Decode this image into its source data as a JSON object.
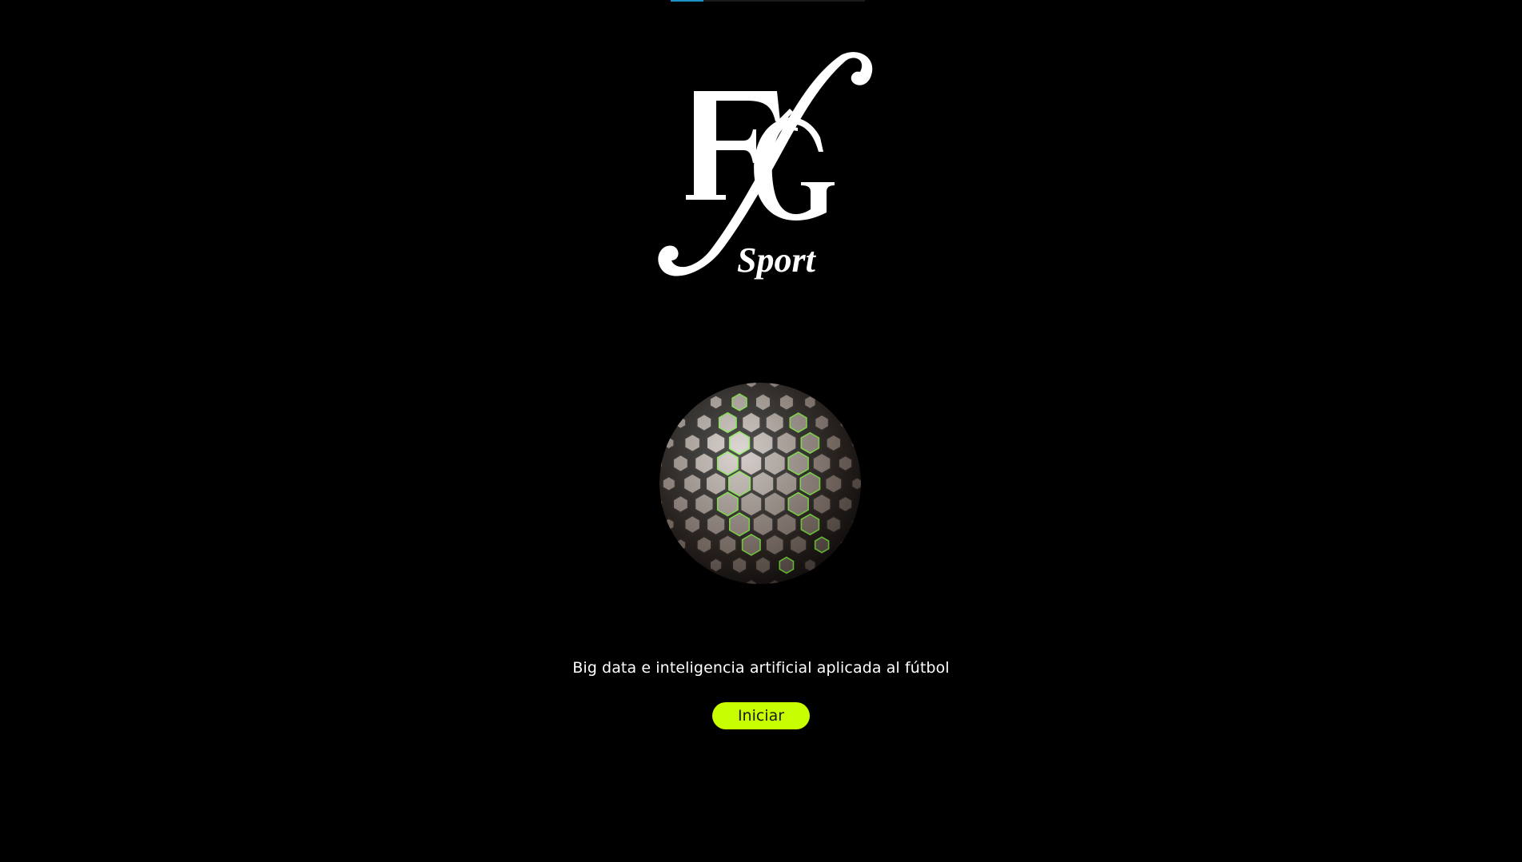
{
  "brand": {
    "logo_text": "FG",
    "logo_subtext": "Sport"
  },
  "loading": {
    "progress": 0.17,
    "color": "#1d93c9"
  },
  "hero": {
    "graphic": "hex-ball-icon",
    "accent_color": "#7dff3a"
  },
  "tagline": "Big data e inteligencia artificial aplicada al fútbol",
  "actions": {
    "start_label": "Iniciar",
    "start_color": "#c8ff00"
  }
}
